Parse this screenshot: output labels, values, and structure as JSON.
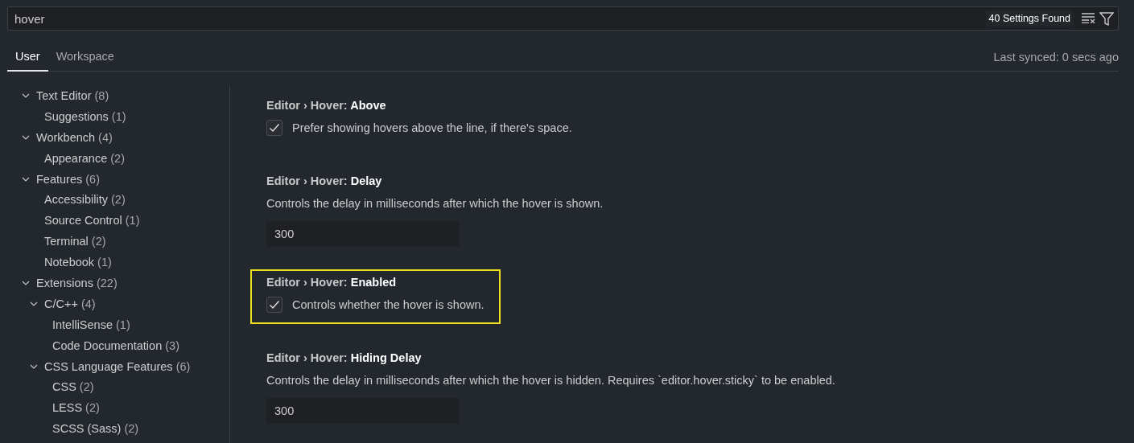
{
  "search": {
    "value": "hover",
    "result_count": "40 Settings Found"
  },
  "tabs": [
    {
      "label": "User",
      "selected": true
    },
    {
      "label": "Workspace",
      "selected": false
    }
  ],
  "sync_status": "Last synced: 0 secs ago",
  "tree": [
    {
      "label": "Text Editor",
      "count": "(8)",
      "expanded": true,
      "children": [
        {
          "label": "Suggestions",
          "count": "(1)"
        }
      ]
    },
    {
      "label": "Workbench",
      "count": "(4)",
      "expanded": true,
      "children": [
        {
          "label": "Appearance",
          "count": "(2)"
        }
      ]
    },
    {
      "label": "Features",
      "count": "(6)",
      "expanded": true,
      "children": [
        {
          "label": "Accessibility",
          "count": "(2)"
        },
        {
          "label": "Source Control",
          "count": "(1)"
        },
        {
          "label": "Terminal",
          "count": "(2)"
        },
        {
          "label": "Notebook",
          "count": "(1)"
        }
      ]
    },
    {
      "label": "Extensions",
      "count": "(22)",
      "expanded": true,
      "children": [
        {
          "label": "C/C++",
          "count": "(4)",
          "expanded": true,
          "children": [
            {
              "label": "IntelliSense",
              "count": "(1)"
            },
            {
              "label": "Code Documentation",
              "count": "(3)"
            }
          ]
        },
        {
          "label": "CSS Language Features",
          "count": "(6)",
          "expanded": true,
          "children": [
            {
              "label": "CSS",
              "count": "(2)"
            },
            {
              "label": "LESS",
              "count": "(2)"
            },
            {
              "label": "SCSS (Sass)",
              "count": "(2)"
            }
          ]
        }
      ]
    }
  ],
  "settings": [
    {
      "kind": "checkbox",
      "category": "Editor › Hover: ",
      "name": "Above",
      "description": "Prefer showing hovers above the line, if there's space.",
      "checked": true,
      "highlighted": false
    },
    {
      "kind": "number",
      "category": "Editor › Hover: ",
      "name": "Delay",
      "description": "Controls the delay in milliseconds after which the hover is shown.",
      "value": "300",
      "highlighted": false
    },
    {
      "kind": "checkbox",
      "category": "Editor › Hover: ",
      "name": "Enabled",
      "description": "Controls whether the hover is shown.",
      "checked": true,
      "highlighted": true
    },
    {
      "kind": "number",
      "category": "Editor › Hover: ",
      "name": "Hiding Delay",
      "description": "Controls the delay in milliseconds after which the hover is hidden. Requires `editor.hover.sticky` to be enabled.",
      "value": "300",
      "highlighted": false
    }
  ]
}
